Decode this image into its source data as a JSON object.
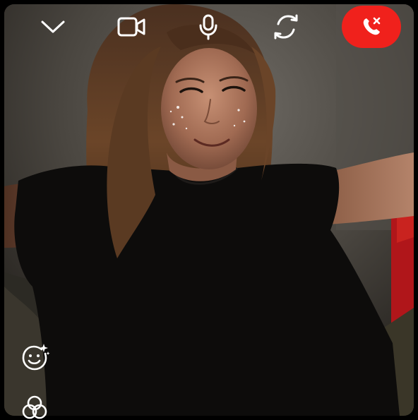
{
  "call": {
    "end_button_color": "#f0211c",
    "icon_color": "#ffffff"
  },
  "top_controls": {
    "collapse_icon": "chevron-down-icon",
    "video_icon": "video-camera-icon",
    "mic_icon": "microphone-icon",
    "flip_icon": "camera-flip-icon",
    "end_icon": "end-call-icon"
  },
  "bottom_controls": {
    "effects_icon": "face-effects-icon",
    "filters_icon": "filters-icon"
  }
}
